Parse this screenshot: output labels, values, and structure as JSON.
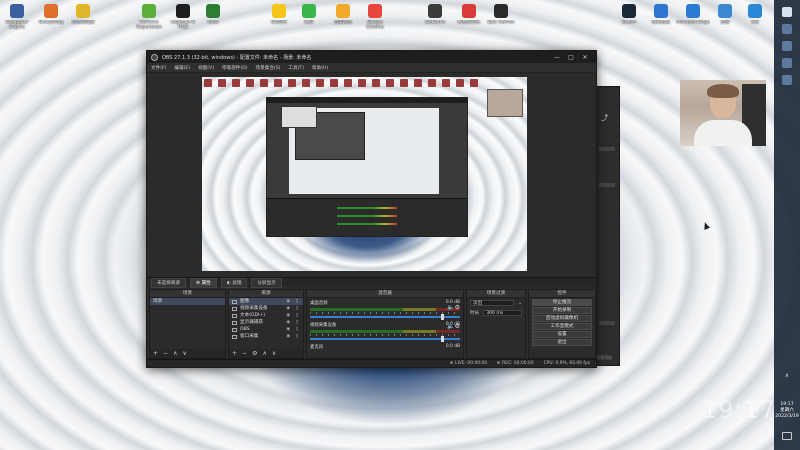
{
  "desktop": {
    "icons": [
      {
        "label": "Wallpaper Engine",
        "color": "#3a5f9e"
      },
      {
        "label": "Everything",
        "color": "#e06f2a"
      },
      {
        "label": "资源管理器",
        "color": "#e0b72a"
      },
      {
        "label": "GeForce Experience",
        "color": "#5cae3a"
      },
      {
        "label": "Logitech G HUB",
        "color": "#1e1e1e"
      },
      {
        "label": "Xbox",
        "color": "#2e7d32"
      },
      {
        "label": "QQ音乐",
        "color": "#f5c518"
      },
      {
        "label": "微信",
        "color": "#39b54a"
      },
      {
        "label": "百度网盘",
        "color": "#f2a92a"
      },
      {
        "label": "Google Chrome",
        "color": "#e8453c"
      },
      {
        "label": "WeGame",
        "color": "#3a3a3a"
      },
      {
        "label": "网易云音乐",
        "color": "#d93a3a"
      },
      {
        "label": "Epic Games",
        "color": "#2a2a2a"
      },
      {
        "label": "Steam",
        "color": "#1b2838"
      },
      {
        "label": "腾讯会议",
        "color": "#2d74d3"
      },
      {
        "label": "Microsoft Edge",
        "color": "#2a7bd3"
      },
      {
        "label": "迅雷",
        "color": "#3a8ad3"
      },
      {
        "label": "QQ",
        "color": "#2a88d8"
      }
    ]
  },
  "obs": {
    "title": "OBS 27.1.3 (32-bit, windows) - 配置文件: 未命名 - 场景: 未命名",
    "win_minimize": "—",
    "win_maximize": "□",
    "win_close": "✕",
    "menu": [
      "文件(F)",
      "编辑(E)",
      "视图(V)",
      "停靠部件(D)",
      "场景集合(S)",
      "工具(T)",
      "帮助(H)"
    ],
    "dock_tabs": {
      "no_source": "未选择来源",
      "properties": "⚙ 属性",
      "filters": "◐ 滤镜",
      "cut": "分屏显示"
    },
    "scenes": {
      "header": "场景",
      "items": [
        "场景"
      ]
    },
    "sources": {
      "header": "来源",
      "items": [
        "图像",
        "视频采集设备",
        "文本(GDI+)",
        "显示器捕获",
        "OBS",
        "窗口采集"
      ]
    },
    "mixer": {
      "header": "混音器",
      "channels": [
        {
          "name": "桌面音频",
          "db": "0.0 dB"
        },
        {
          "name": "视频采集设备",
          "db": "0.0 dB"
        },
        {
          "name": "麦克风",
          "db": "0.0 dB"
        }
      ]
    },
    "transitions": {
      "header": "场景过渡",
      "type": "淡出",
      "duration_label": "时长",
      "duration_value": "300 ms"
    },
    "controls": {
      "header": "控件",
      "buttons": [
        "停止推流",
        "开始录制",
        "启动虚拟摄像机",
        "工作室模式",
        "设置",
        "退出"
      ]
    },
    "status": {
      "live": "LIVE: 00:00:00",
      "rec": "REC: 00:00:00",
      "cpu": "CPU: 0.9%, 60.00 fps"
    },
    "toolbar_glyphs": {
      "add": "+",
      "remove": "−",
      "up": "∧",
      "down": "∨",
      "gear": "⚙"
    }
  },
  "taskbar": {
    "tray_arrow": "∧",
    "time": "19:17",
    "weekday": "星期六",
    "date": "2022/3/19"
  },
  "overlay_clock": "19:17",
  "side_panel_label": "回到顶部"
}
